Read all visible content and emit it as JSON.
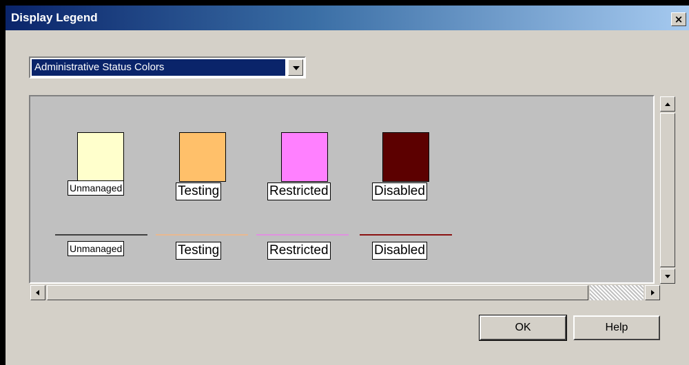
{
  "window": {
    "title": "Display Legend",
    "close_glyph": "×"
  },
  "combo": {
    "selected": "Administrative Status Colors"
  },
  "legend": {
    "swatches": [
      {
        "label": "Unmanaged",
        "color": "#ffffcc"
      },
      {
        "label": "Testing",
        "color": "#ffc06a"
      },
      {
        "label": "Restricted",
        "color": "#ff80ff"
      },
      {
        "label": "Disabled",
        "color": "#5c0000"
      }
    ],
    "lines": [
      {
        "label": "Unmanaged",
        "color": "#404040"
      },
      {
        "label": "Testing",
        "color": "#e8b890"
      },
      {
        "label": "Restricted",
        "color": "#e090e0"
      },
      {
        "label": "Disabled",
        "color": "#8a1010"
      }
    ]
  },
  "buttons": {
    "ok_label": "OK",
    "help_label": "Help"
  },
  "icons": {
    "close": "close-icon",
    "dropdown": "chevron-down-icon",
    "scroll_up": "arrow-up-icon",
    "scroll_down": "arrow-down-icon",
    "scroll_left": "arrow-left-icon",
    "scroll_right": "arrow-right-icon"
  }
}
